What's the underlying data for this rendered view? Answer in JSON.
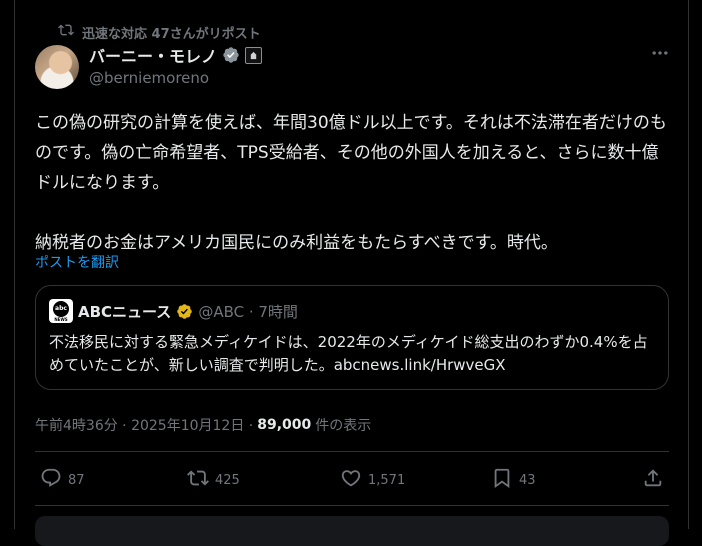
{
  "repost": {
    "label": "迅速な対応 47さんがリポスト"
  },
  "author": {
    "display_name": "バーニー・モレノ",
    "handle": "@berniemoreno"
  },
  "post": {
    "text": "この偽の研究の計算を使えば、年間30億ドル以上です。それは不法滞在者だけのものです。偽の亡命希望者、TPS受給者、その他の外国人を加えると、さらに数十億ドルになります。\n\n納税者のお金はアメリカ国民にのみ利益をもたらすべきです。時代。",
    "translate_label": "ポストを翻訳"
  },
  "quote": {
    "logo_top": "abc",
    "logo_bottom": "NEWS",
    "name": "ABCニュース",
    "meta": "@ABC · 7時間",
    "text": "不法移民に対する緊急メディケイドは、2022年のメディケイド総支出のわずか0.4%を占めていたことが、新しい調査で判明した。abcnews.link/HrwveGX"
  },
  "timestamp": {
    "time": "午前4時36分 · 2025年10月12日 ·",
    "views": "89,000",
    "views_suffix": "件の表示"
  },
  "actions": {
    "replies": "87",
    "reposts": "425",
    "likes": "1,571",
    "bookmarks": "43"
  },
  "colors": {
    "background": "#000000",
    "text": "#e7e9ea",
    "muted": "#71767b",
    "link": "#1d9bf0",
    "border": "#2f3336",
    "verified_blue": "#1d9bf0",
    "verified_gold": "#e2b719"
  },
  "icons": {
    "repost": "repost-icon",
    "verified": "verified-badge-icon",
    "affiliate": "government-affiliate-icon",
    "more": "more-options-icon",
    "reply": "reply-icon",
    "like": "heart-icon",
    "bookmark": "bookmark-icon",
    "share": "share-icon"
  }
}
